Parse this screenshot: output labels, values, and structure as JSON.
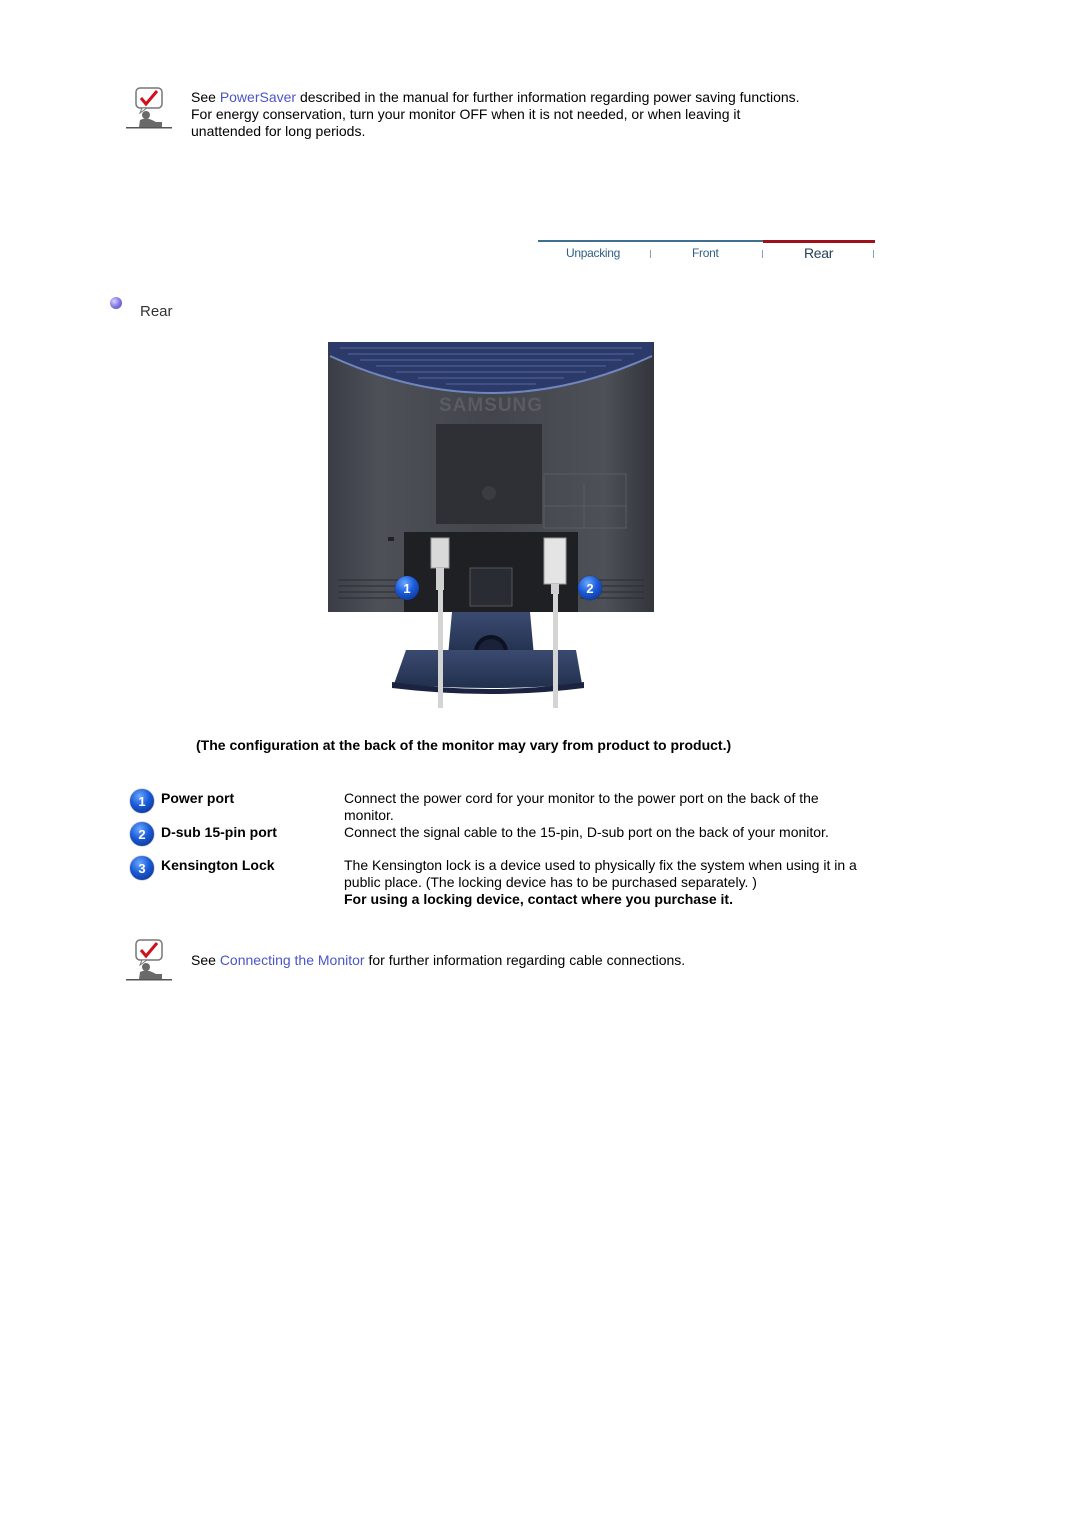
{
  "top_note": {
    "prefix": "See ",
    "link": "PowerSaver",
    "line1_rest": " described in the manual for further information regarding power saving functions.",
    "line2": "For energy conservation, turn your monitor OFF when it is not needed, or when leaving it",
    "line3": "unattended for long periods.",
    "icon": "note-check-icon"
  },
  "nav": {
    "tabs": [
      {
        "label": "Unpacking",
        "active": false
      },
      {
        "label": "Front",
        "active": false
      },
      {
        "label": "Rear",
        "active": true
      }
    ],
    "colors": {
      "inactive_line": "#3f6f8f",
      "active_line": "#a0101a"
    }
  },
  "section": {
    "title": "Rear",
    "bullet_icon": "bullet-icon"
  },
  "figure": {
    "alt": "Rear view of monitor",
    "brand": "SAMSUNG",
    "callouts": [
      "1",
      "2"
    ]
  },
  "caption": "(The configuration at the back of the monitor may vary from product to product.)",
  "items": [
    {
      "number": "1",
      "label": "Power port",
      "desc": "Connect the power cord for your monitor to the power port on the back of the monitor."
    },
    {
      "number": "2",
      "label": "D-sub 15-pin port",
      "desc": "Connect the signal cable to the 15-pin, D-sub port on the back of your monitor."
    },
    {
      "number": "3",
      "label": "Kensington Lock",
      "desc": "The Kensington lock is a device used to physically fix the system when using it in a public place. (The locking device has to be purchased separately. )",
      "desc_bold": "For using a locking device, contact where you purchase it."
    }
  ],
  "bottom_note": {
    "prefix": "See ",
    "link": "Connecting the Monitor",
    "rest": " for further information regarding cable connections.",
    "icon": "note-check-icon"
  }
}
